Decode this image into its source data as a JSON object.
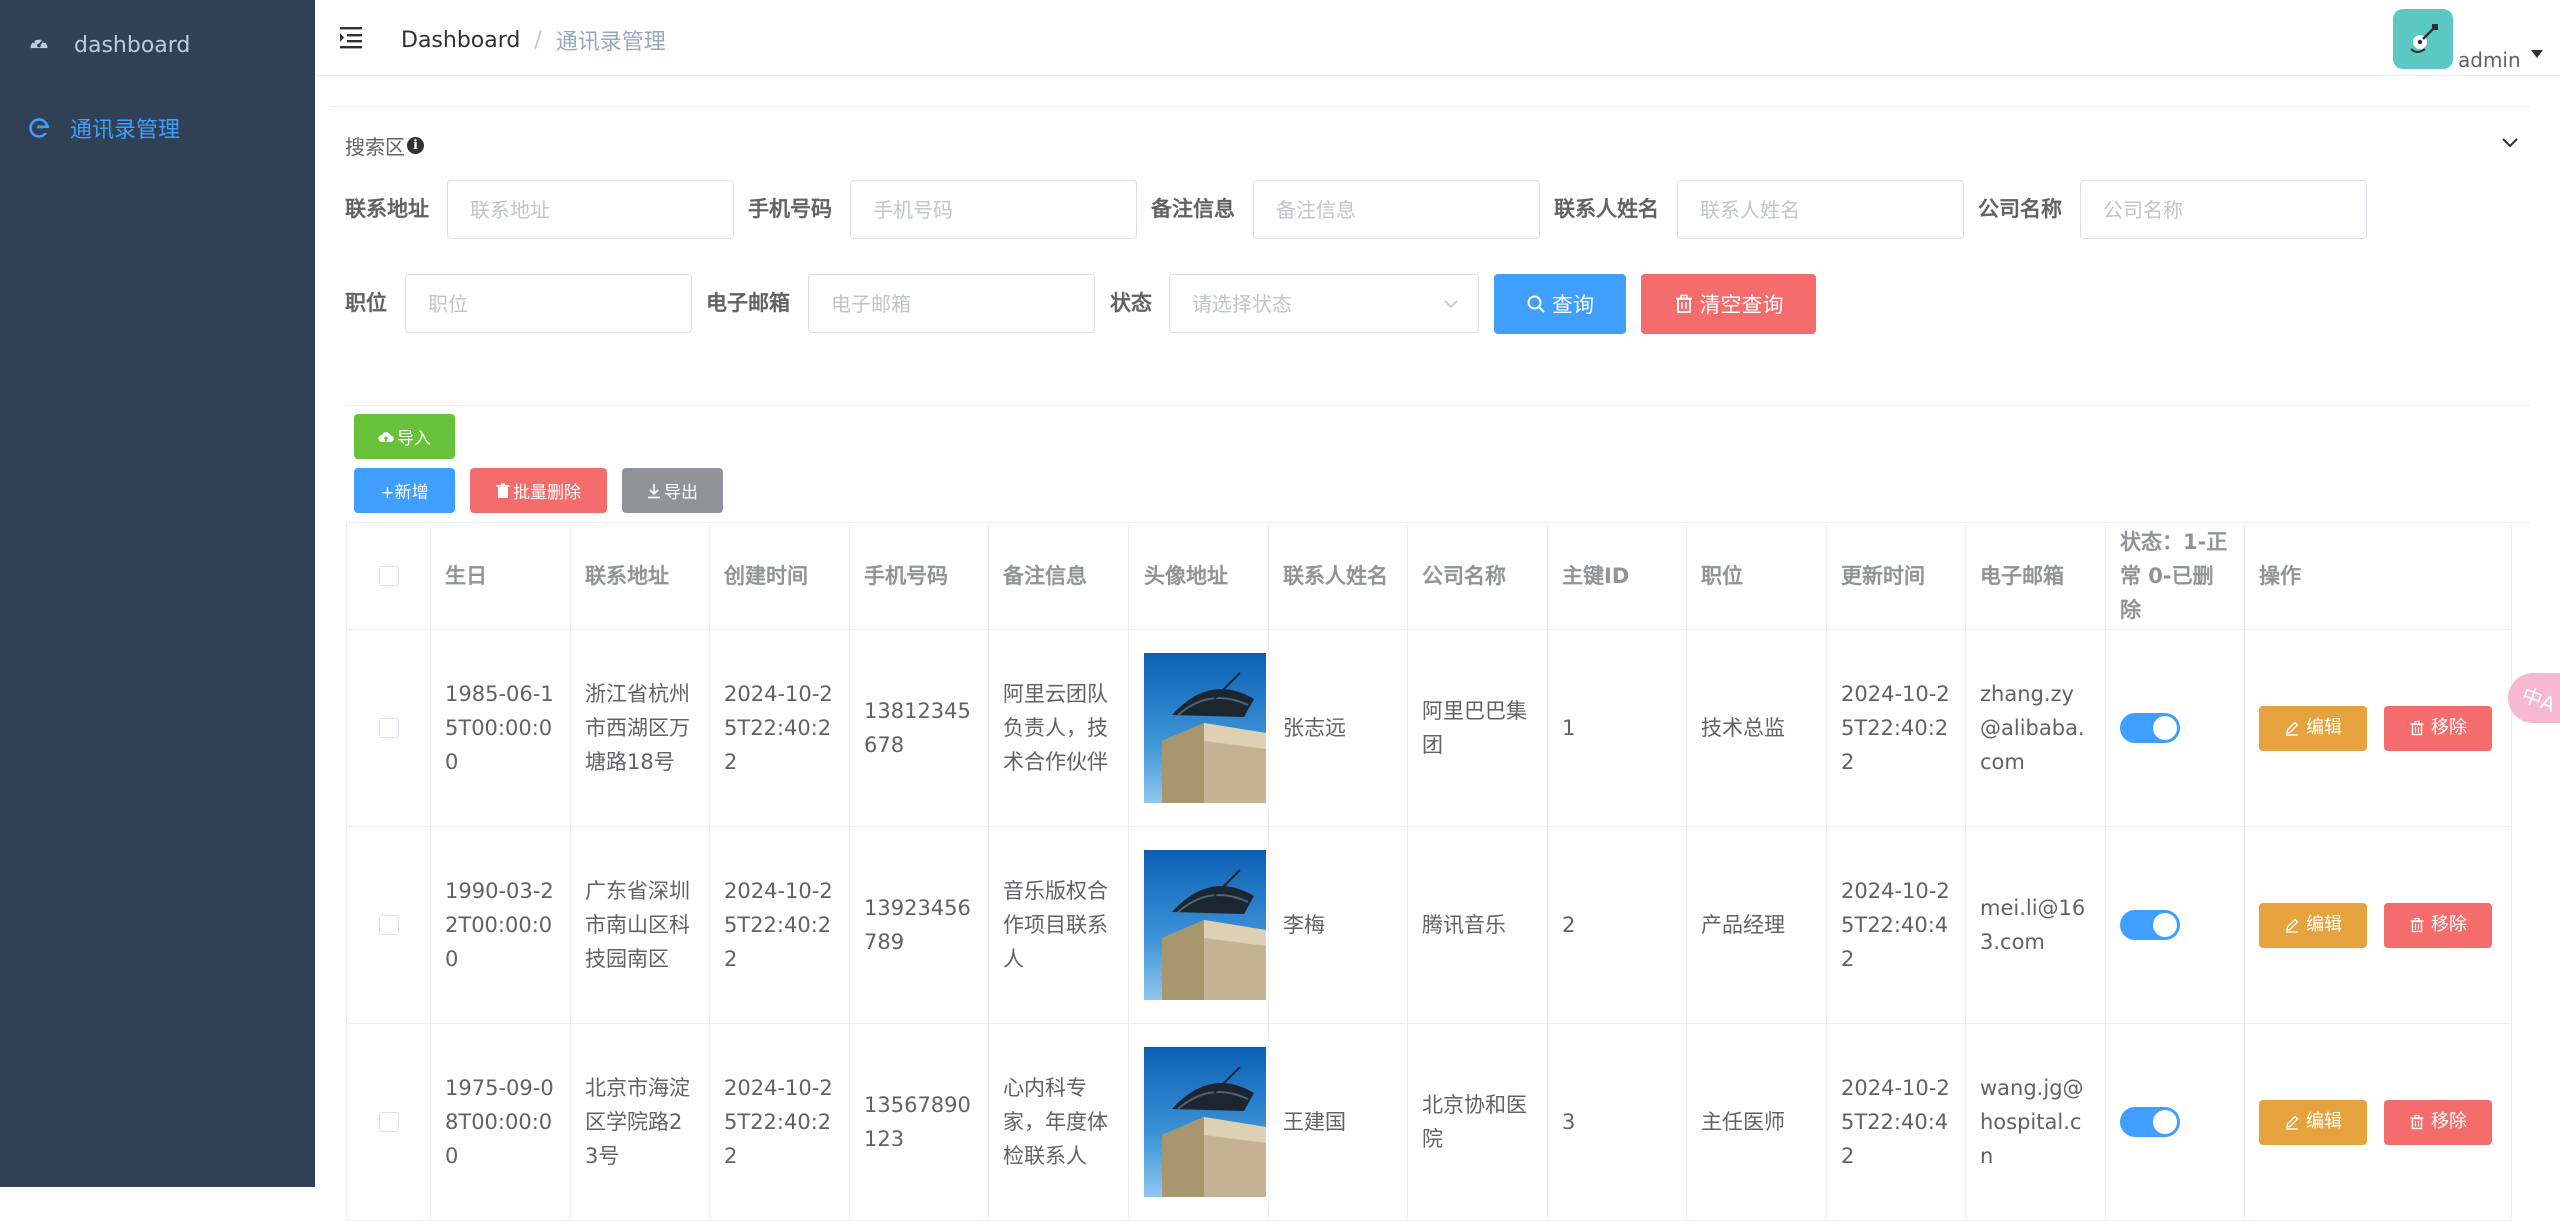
{
  "sidebar": {
    "items": [
      {
        "label": "dashboard",
        "icon": "dashboard-icon"
      },
      {
        "label": "通讯录管理",
        "icon": "edge-icon",
        "active": true
      }
    ]
  },
  "navbar": {
    "breadcrumb_home": "Dashboard",
    "breadcrumb_separator": "/",
    "breadcrumb_current": "通讯录管理",
    "user": "admin"
  },
  "search": {
    "title": "搜索区",
    "fields": {
      "address": {
        "label": "联系地址",
        "placeholder": "联系地址"
      },
      "phone": {
        "label": "手机号码",
        "placeholder": "手机号码"
      },
      "note": {
        "label": "备注信息",
        "placeholder": "备注信息"
      },
      "name": {
        "label": "联系人姓名",
        "placeholder": "联系人姓名"
      },
      "company": {
        "label": "公司名称",
        "placeholder": "公司名称"
      },
      "position": {
        "label": "职位",
        "placeholder": "职位"
      },
      "email": {
        "label": "电子邮箱",
        "placeholder": "电子邮箱"
      },
      "status": {
        "label": "状态",
        "placeholder": "请选择状态"
      }
    },
    "query_label": "查询",
    "clear_label": "清空查询"
  },
  "toolbar": {
    "import_label": "导入",
    "add_label": "+新增",
    "batch_delete_label": "批量删除",
    "export_label": "导出"
  },
  "table": {
    "headers": {
      "birthday": "生日",
      "address": "联系地址",
      "created": "创建时间",
      "phone": "手机号码",
      "note": "备注信息",
      "avatar": "头像地址",
      "name": "联系人姓名",
      "company": "公司名称",
      "id": "主键ID",
      "position": "职位",
      "updated": "更新时间",
      "email": "电子邮箱",
      "status": "状态：1-正常 0-已删除",
      "operation": "操作"
    },
    "rows": [
      {
        "birthday": "1985-06-15T00:00:00",
        "address": "浙江省杭州市西湖区万塘路18号",
        "created": "2024-10-25T22:40:22",
        "phone": "13812345678",
        "note": "阿里云团队负责人，技术合作伙伴",
        "name": "张志远",
        "company": "阿里巴巴集团",
        "id": "1",
        "position": "技术总监",
        "updated": "2024-10-25T22:40:22",
        "email": "zhang.zy@alibaba.com",
        "status_on": true,
        "edit": "编辑",
        "remove": "移除"
      },
      {
        "birthday": "1990-03-22T00:00:00",
        "address": "广东省深圳市南山区科技园南区",
        "created": "2024-10-25T22:40:22",
        "phone": "13923456789",
        "note": "音乐版权合作项目联系人",
        "name": "李梅",
        "company": "腾讯音乐",
        "id": "2",
        "position": "产品经理",
        "updated": "2024-10-25T22:40:42",
        "email": "mei.li@163.com",
        "status_on": true,
        "edit": "编辑",
        "remove": "移除"
      },
      {
        "birthday": "1975-09-08T00:00:00",
        "address": "北京市海淀区学院路23号",
        "created": "2024-10-25T22:40:22",
        "phone": "13567890123",
        "note": "心内科专家，年度体检联系人",
        "name": "王建国",
        "company": "北京协和医院",
        "id": "3",
        "position": "主任医师",
        "updated": "2024-10-25T22:40:42",
        "email": "wang.jg@hospital.cn",
        "status_on": true,
        "edit": "编辑",
        "remove": "移除"
      }
    ]
  },
  "colors": {
    "sidebar_bg": "#304156",
    "primary": "#409eff",
    "danger": "#f56c6c",
    "success": "#67c23a",
    "warning": "#e6a23c",
    "info": "#909399"
  },
  "float_tab_label": "中A"
}
